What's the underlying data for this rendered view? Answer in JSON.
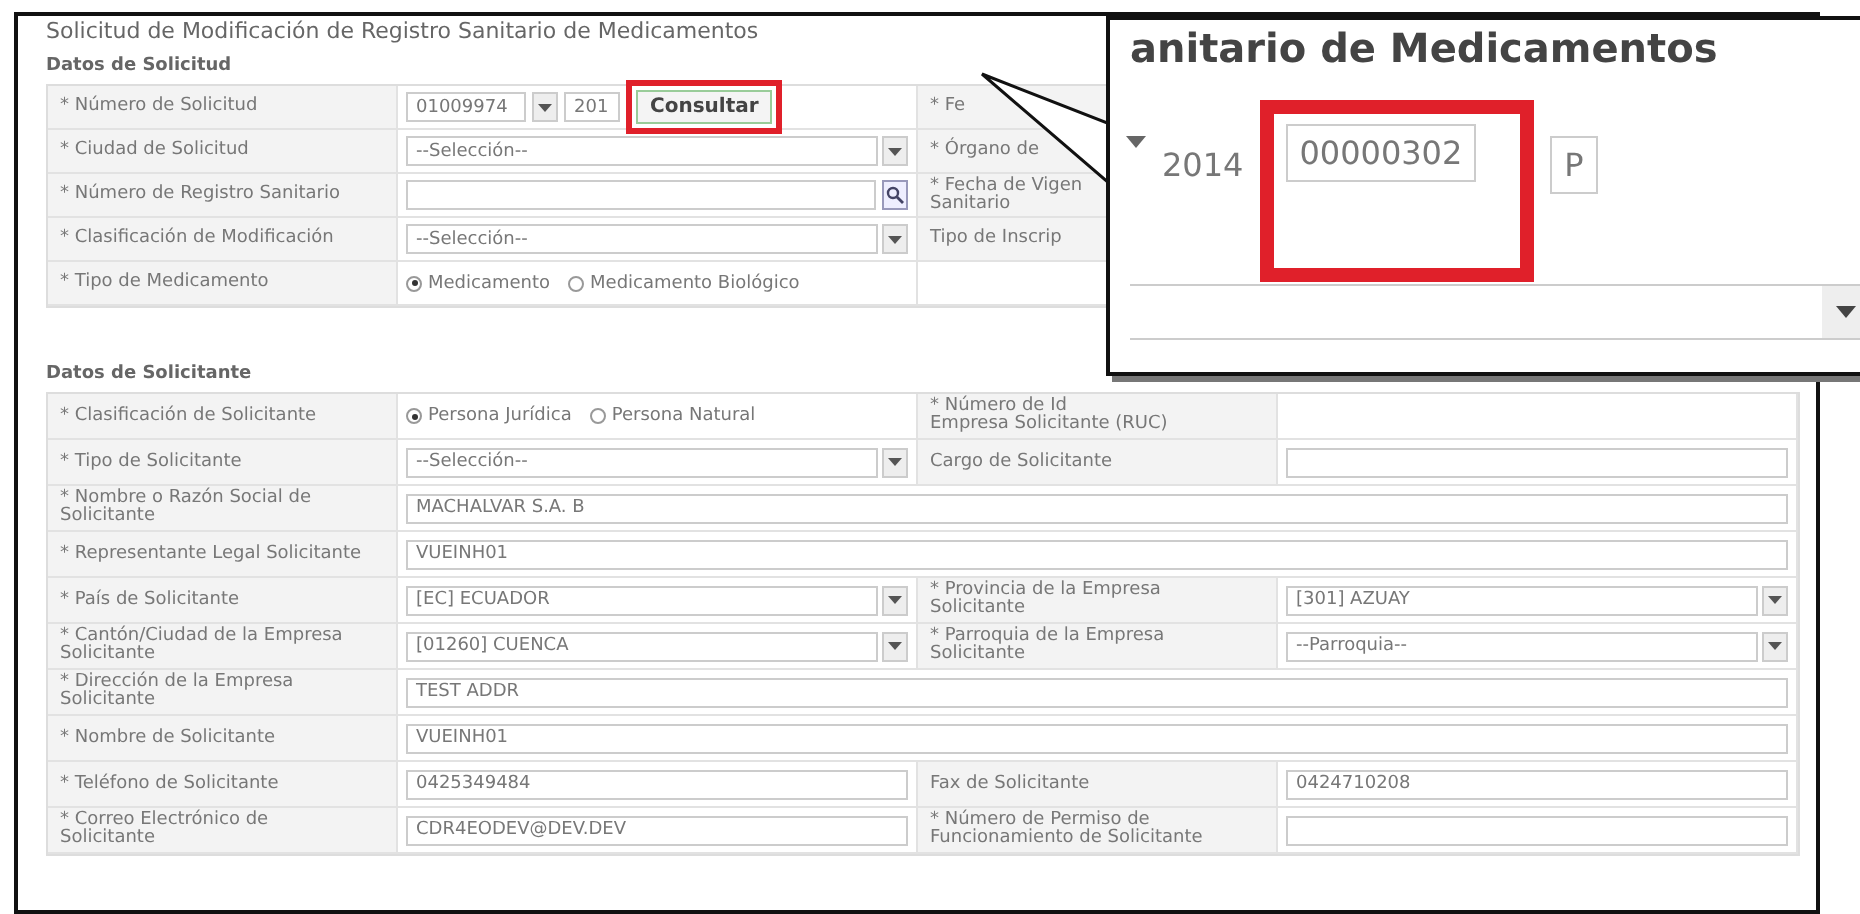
{
  "title": "Solicitud de Modificación de Registro Sanitario de Medicamentos",
  "sections": [
    {
      "heading": "Datos de Solicitud",
      "rows": [
        {
          "kind": "split",
          "cells": [
            {
              "kind": "label",
              "lines": [
                "* Número de Solicitud"
              ]
            },
            {
              "kind": "request",
              "number": "01009974",
              "year": "201",
              "button": "Consultar"
            },
            {
              "kind": "label",
              "lines": [
                "* Fe"
              ]
            },
            {
              "kind": "blank"
            }
          ]
        },
        {
          "kind": "split",
          "cells": [
            {
              "kind": "label",
              "lines": [
                "* Ciudad de Solicitud"
              ]
            },
            {
              "kind": "select",
              "value": "--Selección--"
            },
            {
              "kind": "label",
              "lines": [
                "* Órgano de"
              ]
            },
            {
              "kind": "blank"
            }
          ]
        },
        {
          "kind": "split",
          "cells": [
            {
              "kind": "label",
              "lines": [
                "* Número de Registro Sanitario"
              ]
            },
            {
              "kind": "search"
            },
            {
              "kind": "label",
              "lines": [
                "* Fecha de Vigen",
                "Sanitario"
              ]
            },
            {
              "kind": "blank"
            }
          ]
        },
        {
          "kind": "split",
          "cells": [
            {
              "kind": "label",
              "lines": [
                "* Clasificación de Modificación"
              ]
            },
            {
              "kind": "select",
              "value": "--Selección--"
            },
            {
              "kind": "label",
              "lines": [
                "Tipo de Inscrip"
              ]
            },
            {
              "kind": "blank"
            }
          ]
        },
        {
          "kind": "split",
          "cells": [
            {
              "kind": "label",
              "lines": [
                "* Tipo de Medicamento"
              ]
            },
            {
              "kind": "radios",
              "options": [
                {
                  "label": "Medicamento",
                  "selected": true
                },
                {
                  "label": "Medicamento Biológico",
                  "selected": false
                }
              ]
            },
            {
              "kind": "blank"
            },
            {
              "kind": "blank"
            }
          ]
        }
      ]
    },
    {
      "heading": "Datos de Solicitante",
      "rows": [
        {
          "kind": "split",
          "cells": [
            {
              "kind": "label",
              "lines": [
                "* Clasificación de Solicitante"
              ]
            },
            {
              "kind": "radios",
              "options": [
                {
                  "label": "Persona Jurídica",
                  "selected": true
                },
                {
                  "label": "Persona Natural",
                  "selected": false
                }
              ]
            },
            {
              "kind": "label",
              "lines": [
                "* Número de Id",
                "Empresa Solicitante (RUC)"
              ]
            },
            {
              "kind": "blank"
            }
          ]
        },
        {
          "kind": "split",
          "cells": [
            {
              "kind": "label",
              "lines": [
                "* Tipo de Solicitante"
              ]
            },
            {
              "kind": "select",
              "value": "--Selección--"
            },
            {
              "kind": "label",
              "lines": [
                "Cargo de Solicitante"
              ]
            },
            {
              "kind": "input"
            }
          ]
        },
        {
          "kind": "full",
          "cells": [
            {
              "kind": "label",
              "lines": [
                "* Nombre o Razón Social de",
                "Solicitante"
              ]
            },
            {
              "kind": "input",
              "value": "MACHALVAR S.A. B"
            }
          ]
        },
        {
          "kind": "full",
          "cells": [
            {
              "kind": "label",
              "lines": [
                "* Representante Legal Solicitante"
              ]
            },
            {
              "kind": "input",
              "value": "VUEINH01"
            }
          ]
        },
        {
          "kind": "split",
          "cells": [
            {
              "kind": "label",
              "lines": [
                "* País de Solicitante"
              ]
            },
            {
              "kind": "select",
              "value": "[EC] ECUADOR"
            },
            {
              "kind": "label",
              "lines": [
                "* Provincia de la Empresa",
                "Solicitante"
              ]
            },
            {
              "kind": "select",
              "value": "[301] AZUAY"
            }
          ]
        },
        {
          "kind": "split",
          "cells": [
            {
              "kind": "label",
              "lines": [
                "* Cantón/Ciudad de la Empresa",
                "Solicitante"
              ]
            },
            {
              "kind": "select",
              "value": "[01260] CUENCA"
            },
            {
              "kind": "label",
              "lines": [
                "* Parroquia de la Empresa",
                "Solicitante"
              ]
            },
            {
              "kind": "select",
              "value": "--Parroquia--"
            }
          ]
        },
        {
          "kind": "full",
          "cells": [
            {
              "kind": "label",
              "lines": [
                "* Dirección de la Empresa",
                "Solicitante"
              ]
            },
            {
              "kind": "input",
              "value": "TEST ADDR"
            }
          ]
        },
        {
          "kind": "full",
          "cells": [
            {
              "kind": "label",
              "lines": [
                "* Nombre de Solicitante"
              ]
            },
            {
              "kind": "input",
              "value": "VUEINH01"
            }
          ]
        },
        {
          "kind": "split",
          "cells": [
            {
              "kind": "label",
              "lines": [
                "* Teléfono de Solicitante"
              ]
            },
            {
              "kind": "input",
              "value": "0425349484"
            },
            {
              "kind": "label",
              "lines": [
                "Fax de Solicitante"
              ]
            },
            {
              "kind": "input",
              "value": "0424710208"
            }
          ]
        },
        {
          "kind": "split",
          "cells": [
            {
              "kind": "label",
              "lines": [
                "* Correo Electrónico de",
                "Solicitante"
              ]
            },
            {
              "kind": "input",
              "value": "CDR4EODEV@DEV.DEV"
            },
            {
              "kind": "label",
              "lines": [
                "* Número de Permiso de",
                "Funcionamiento de Solicitante"
              ]
            },
            {
              "kind": "input"
            }
          ]
        }
      ]
    }
  ],
  "callout": {
    "title": "anitario de Medicamentos",
    "year": "2014",
    "number": "00000302",
    "suffix": "P"
  }
}
